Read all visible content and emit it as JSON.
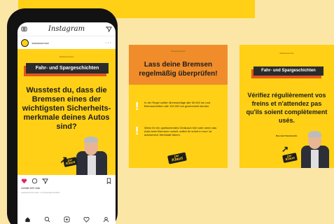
{
  "instagram": {
    "app_title": "Instagram",
    "username": "1aautoservice",
    "likes": "Gefällt 520 Mal",
    "caption": "1aautoservice Fahr- und Spargeschichten",
    "icons": [
      "camera-icon",
      "send-icon",
      "heart-icon",
      "comment-icon",
      "share-icon",
      "bookmark-icon",
      "home-icon",
      "search-icon",
      "add-icon",
      "heart-nav-icon",
      "profile-icon"
    ],
    "heart_color": "#e0245e"
  },
  "post": {
    "tag": "#1aautoservice",
    "banner": "Fahr- und Spargeschichten",
    "question": "Wusstest du, dass die Bremsen eines der wichtigsten Sicherheits-merkmale deines Autos sind?",
    "badge_top": "Der",
    "badge_bottom": "Klaus"
  },
  "card2": {
    "tag": "#1aautoservice",
    "title": "Lass deine Bremsen regelmäßig überprüfen!",
    "point1": "In der Regel sollten Bremsbeläge alle 50.000 km und Bremsscheiben alle 100.000 km gewechselt werden.",
    "point2": "Wenn ihr ein quietschendes Geräusch hört oder wenn das Auto beim Bremsen ruckelt, solltet ihr sofort in eure 1a autoservice Werkstatt fahren.",
    "badge_top": "Der",
    "badge_bottom": "Klaus"
  },
  "card3": {
    "tag": "#1aautoservice",
    "banner": "Fahr- und Spargeschichten",
    "text": "Vérifiez régulièrement vos freins et n'attendez pas qu'ils soient complètement usés.",
    "signature": "Das war Französisch.",
    "badge_top": "Der",
    "badge_bottom": "Klaus"
  },
  "colors": {
    "brand_yellow": "#ffd015",
    "banner_dark": "#2b2b2b",
    "accent_orange": "#e2571d",
    "header_orange": "#f08c2a",
    "background": "#fbe6a5"
  }
}
